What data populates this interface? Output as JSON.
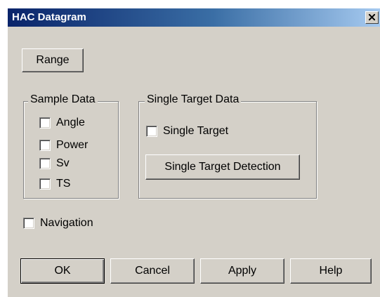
{
  "window": {
    "title": "HAC Datagram",
    "close_glyph": "×"
  },
  "range_button": {
    "label": "Range"
  },
  "sample_data": {
    "title": "Sample Data",
    "items": [
      {
        "label": "Angle",
        "checked": false
      },
      {
        "label": "Power",
        "checked": false
      },
      {
        "label": "Sv",
        "checked": false
      },
      {
        "label": "TS",
        "checked": false
      }
    ]
  },
  "single_target_data": {
    "title": "Single Target Data",
    "checkbox": {
      "label": "Single Target",
      "checked": false
    },
    "detection_button": {
      "label": "Single Target Detection"
    }
  },
  "navigation": {
    "label": "Navigation",
    "checked": false
  },
  "footer_buttons": {
    "ok": "OK",
    "cancel": "Cancel",
    "apply": "Apply",
    "help": "Help"
  },
  "colors": {
    "dialog_bg": "#d4d0c8",
    "titlebar_start": "#0a246a",
    "titlebar_end": "#a6caf0",
    "title_text": "#ffffff"
  },
  "icons": {
    "close": "close-icon"
  }
}
